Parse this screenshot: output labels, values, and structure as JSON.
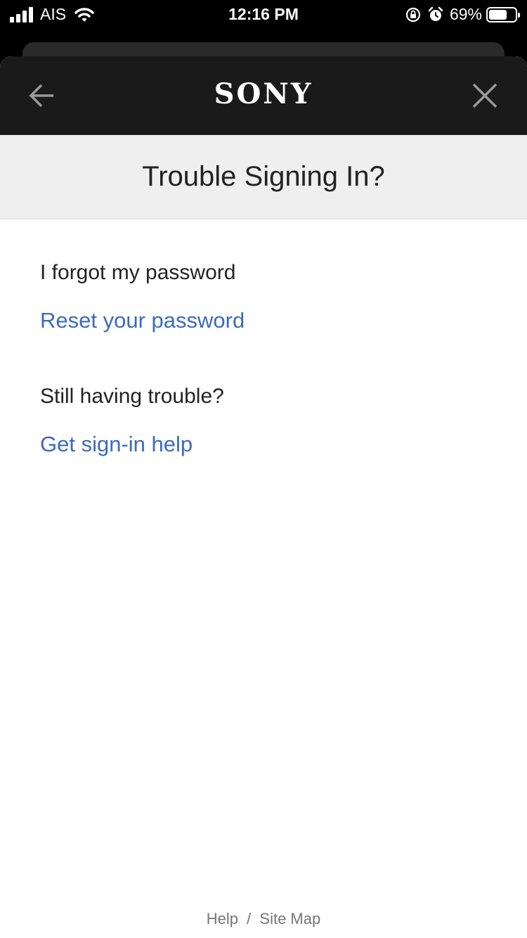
{
  "status_bar": {
    "carrier": "AIS",
    "time": "12:16 PM",
    "battery_percent": "69%",
    "battery_level": 0.69,
    "icons": [
      "signal-icon",
      "wifi-icon",
      "orientation-lock-icon",
      "alarm-icon",
      "battery-icon"
    ]
  },
  "header": {
    "logo": "SONY",
    "back_icon": "arrow-left-icon",
    "close_icon": "close-icon"
  },
  "page": {
    "title": "Trouble Signing In?"
  },
  "sections": [
    {
      "heading": "I forgot my password",
      "link": "Reset your password"
    },
    {
      "heading": "Still having trouble?",
      "link": "Get sign-in help"
    }
  ],
  "footer": {
    "help": "Help",
    "separator": "/",
    "site_map": "Site Map"
  },
  "colors": {
    "header_bg": "#1a1a1a",
    "title_band_bg": "#efefef",
    "link": "#3d6abf",
    "text": "#222222"
  }
}
